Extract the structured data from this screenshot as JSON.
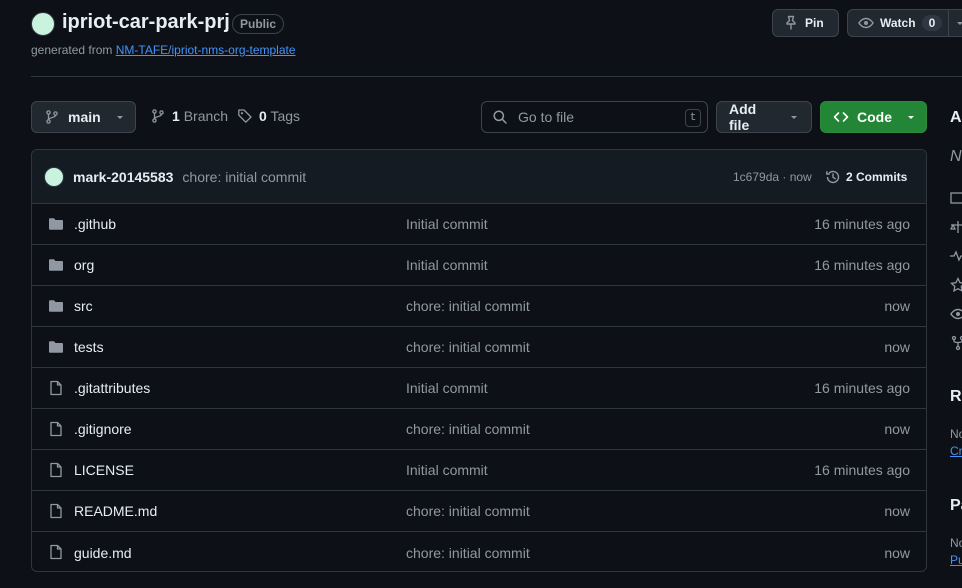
{
  "repo": {
    "name": "ipriot-car-park-prj",
    "visibility": "Public",
    "generated_prefix": "generated from ",
    "template_link": "NM-TAFE/ipriot-nms-org-template"
  },
  "header_actions": {
    "pin_label": "Pin",
    "watch_label": "Watch",
    "watch_count": "0"
  },
  "toolbar": {
    "branch": "main",
    "branch_count": "1",
    "branch_label": "Branch",
    "tag_count": "0",
    "tag_label": "Tags",
    "search_placeholder": "Go to file",
    "search_shortcut": "t",
    "add_file_label": "Add file",
    "code_label": "Code"
  },
  "latest_commit": {
    "author": "mark-20145583",
    "message": "chore: initial commit",
    "hash_time": "1c679da · now",
    "commits_label": "2 Commits"
  },
  "files": [
    {
      "type": "folder",
      "name": ".github",
      "commit": "Initial commit",
      "time": "16 minutes ago"
    },
    {
      "type": "folder",
      "name": "org",
      "commit": "Initial commit",
      "time": "16 minutes ago"
    },
    {
      "type": "folder",
      "name": "src",
      "commit": "chore: initial commit",
      "time": "now"
    },
    {
      "type": "folder",
      "name": "tests",
      "commit": "chore: initial commit",
      "time": "now"
    },
    {
      "type": "file",
      "name": ".gitattributes",
      "commit": "Initial commit",
      "time": "16 minutes ago"
    },
    {
      "type": "file",
      "name": ".gitignore",
      "commit": "chore: initial commit",
      "time": "now"
    },
    {
      "type": "file",
      "name": "LICENSE",
      "commit": "Initial commit",
      "time": "16 minutes ago"
    },
    {
      "type": "file",
      "name": "README.md",
      "commit": "chore: initial commit",
      "time": "now"
    },
    {
      "type": "file",
      "name": "guide.md",
      "commit": "chore: initial commit",
      "time": "now"
    }
  ],
  "sidebar_partial": {
    "about_heading": "A",
    "about_desc": "N",
    "icons": [
      "book-icon",
      "scale-icon",
      "pulse-icon",
      "star-icon",
      "eye-icon",
      "fork-icon"
    ],
    "releases_heading": "Re",
    "releases_no": "No",
    "releases_link": "Cr",
    "packages_heading": "Pa",
    "packages_no": "No",
    "packages_link": "Pu"
  },
  "colors": {
    "background": "#0d1117",
    "border": "#30363d",
    "accent_green": "#238636",
    "link_blue": "#4493f8",
    "muted_text": "#9198a1"
  }
}
